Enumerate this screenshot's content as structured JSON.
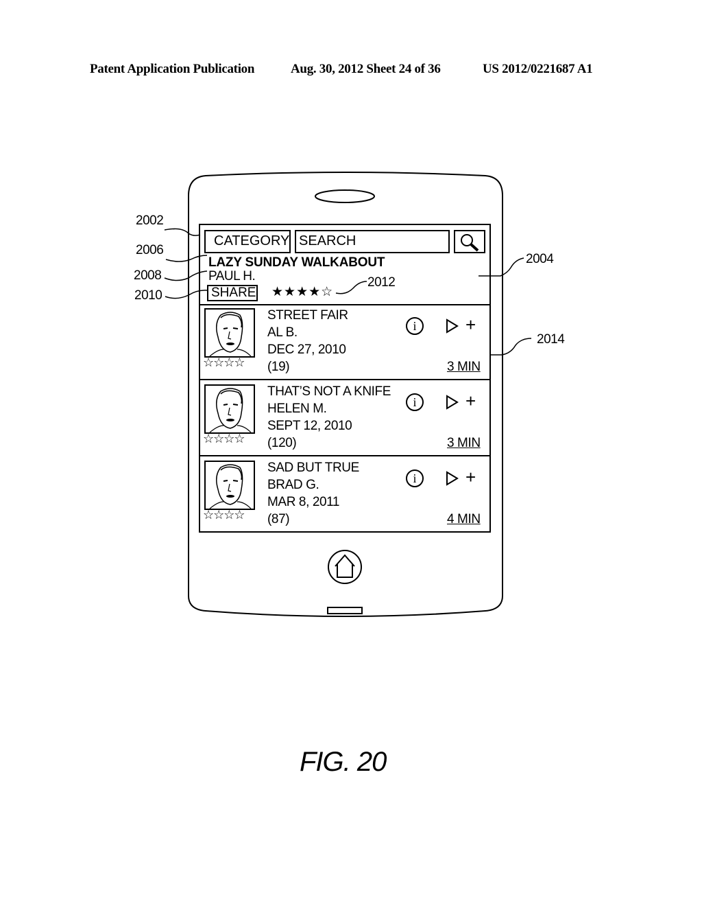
{
  "header": {
    "left": "Patent Application Publication",
    "middle": "Aug. 30, 2012  Sheet 24 of 36",
    "right": "US 2012/0221687 A1"
  },
  "app": {
    "category_label": "CATEGORY",
    "search_placeholder": "SEARCH",
    "search_icon": "magnifier-icon",
    "featured": {
      "title": "LAZY SUNDAY WALKABOUT",
      "author": "PAUL H.",
      "share_label": "SHARE",
      "rating_stars": "★★★★☆",
      "rating": 4,
      "rating_max": 5
    },
    "items": [
      {
        "title": "STREET FAIR",
        "author": "AL B.",
        "date": "DEC 27, 2010",
        "count": "(19)",
        "duration": "3 MIN",
        "stars": "☆☆☆☆"
      },
      {
        "title": "THAT’S NOT A KNIFE",
        "author": "HELEN M.",
        "date": "SEPT 12, 2010",
        "count": "(120)",
        "duration": "3 MIN",
        "stars": "☆☆☆☆"
      },
      {
        "title": "SAD BUT TRUE",
        "author": "BRAD G.",
        "date": "MAR 8, 2011",
        "count": "(87)",
        "duration": "4 MIN",
        "stars": "☆☆☆☆"
      }
    ],
    "info_glyph": "i",
    "plus_glyph": "+"
  },
  "refs": {
    "r2002": "2002",
    "r2004": "2004",
    "r2006": "2006",
    "r2008": "2008",
    "r2010": "2010",
    "r2012": "2012",
    "r2014": "2014"
  },
  "caption": "FIG. 20"
}
